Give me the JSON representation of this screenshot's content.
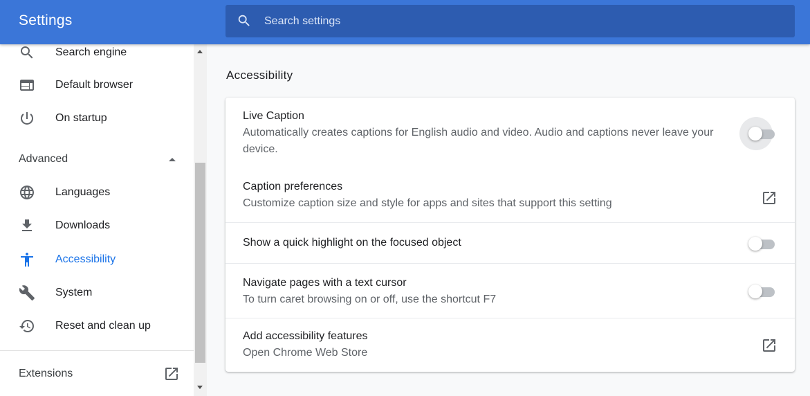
{
  "header": {
    "title": "Settings",
    "search_placeholder": "Search settings"
  },
  "sidebar": {
    "items_top": [
      {
        "label": "Search engine",
        "icon": "search-icon"
      },
      {
        "label": "Default browser",
        "icon": "browser-window-icon"
      },
      {
        "label": "On startup",
        "icon": "power-icon"
      }
    ],
    "advanced_label": "Advanced",
    "items_advanced": [
      {
        "label": "Languages",
        "icon": "globe-icon"
      },
      {
        "label": "Downloads",
        "icon": "download-icon"
      },
      {
        "label": "Accessibility",
        "icon": "accessibility-icon",
        "active": true
      },
      {
        "label": "System",
        "icon": "wrench-icon"
      },
      {
        "label": "Reset and clean up",
        "icon": "history-icon"
      }
    ],
    "extensions_label": "Extensions"
  },
  "main": {
    "section_title": "Accessibility",
    "rows": [
      {
        "title": "Live Caption",
        "subtitle_line1": "Automatically creates captions for English audio and video. Audio and captions never leave your",
        "subtitle_line2": "device.",
        "control": "toggle",
        "enabled": false
      },
      {
        "title": "Caption preferences",
        "subtitle_line1": "Customize caption size and style for apps and sites that support this setting",
        "control": "external-link"
      },
      {
        "title": "Show a quick highlight on the focused object",
        "control": "toggle",
        "enabled": false
      },
      {
        "title": "Navigate pages with a text cursor",
        "subtitle_line1": "To turn caret browsing on or off, use the shortcut F7",
        "control": "toggle",
        "enabled": false
      },
      {
        "title": "Add accessibility features",
        "subtitle_line1": "Open Chrome Web Store",
        "control": "external-link"
      }
    ]
  },
  "colors": {
    "header_bg": "#3b76d8",
    "search_bg": "#2d5cb0",
    "accent": "#1a73e8",
    "icon_gray": "#5f6368",
    "toggle_track_off": "#bdc1c6"
  }
}
